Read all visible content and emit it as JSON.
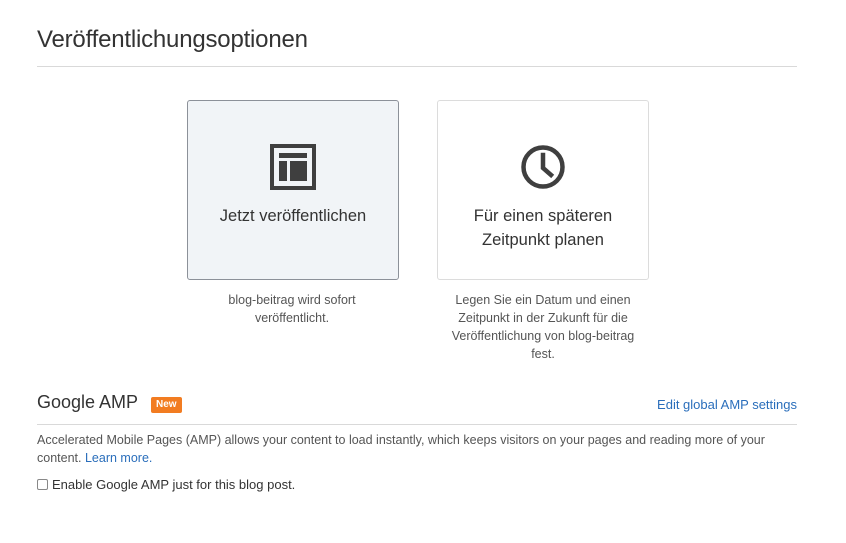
{
  "page": {
    "title": "Veröffentlichungsoptionen"
  },
  "publish_options": [
    {
      "id": "now",
      "label": "Jetzt veröffentlichen",
      "description": "blog-beitrag wird sofort veröffentlicht.",
      "icon": "layout-icon",
      "selected": true
    },
    {
      "id": "later",
      "label": "Für einen späteren Zeitpunkt planen",
      "description": "Legen Sie ein Datum und einen Zeitpunkt in der Zukunft für die Veröffentlichung von blog-beitrag fest.",
      "icon": "clock-icon",
      "selected": false
    }
  ],
  "amp": {
    "title": "Google AMP",
    "badge": "New",
    "settings_link": "Edit global AMP settings",
    "description": "Accelerated Mobile Pages (AMP) allows your content to load instantly, which keeps visitors on your pages and reading more of your content.",
    "learn_more": "Learn more.",
    "checkbox_label": "Enable Google AMP just for this blog post.",
    "checkbox_checked": false
  },
  "colors": {
    "link": "#2a6ebb",
    "badge": "#f27c21",
    "selected_card_bg": "#f1f4f7",
    "icon": "#3f3f3f"
  }
}
